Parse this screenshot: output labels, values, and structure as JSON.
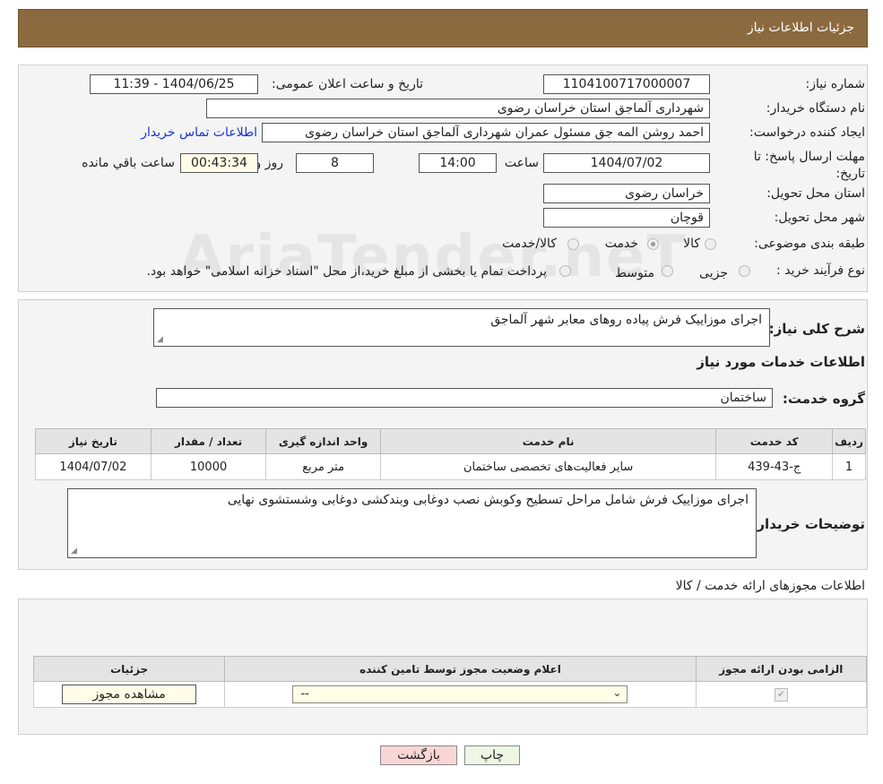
{
  "header": {
    "title": "جزئیات اطلاعات نیاز"
  },
  "watermark": {
    "text": "AriaTender.neT"
  },
  "info": {
    "need_number_label": "شماره نیاز:",
    "need_number": "1104100717000007",
    "announce_label": "تاریخ و ساعت اعلان عمومی:",
    "announce_value": "1404/06/25 - 11:39",
    "buyer_org_label": "نام دستگاه خریدار:",
    "buyer_org": "شهرداری آلماجق استان خراسان رضوی",
    "requester_label": "ایجاد کننده درخواست:",
    "requester": "احمد روشن المه جق مسئول عمران شهرداری آلماجق استان خراسان رضوی",
    "contact_link": "اطلاعات تماس خریدار",
    "deadline_label": "مهلت ارسال پاسخ: تا تاریخ:",
    "deadline_date": "1404/07/02",
    "hour_label": "ساعت",
    "deadline_time": "14:00",
    "days_value": "8",
    "days_label": "روز و",
    "remaining_time": "00:43:34",
    "remaining_label": "ساعت باقي مانده",
    "province_label": "استان محل تحویل:",
    "province": "خراسان رضوی",
    "city_label": "شهر محل تحویل:",
    "city": "قوچان",
    "category_label": "طبقه بندی موضوعی:",
    "category_options": [
      "کالا",
      "خدمت",
      "کالا/خدمت"
    ],
    "category_selected": "خدمت",
    "process_label": "نوع فرآیند خرید :",
    "process_options": [
      "جزیی",
      "متوسط"
    ],
    "process_note": "پرداخت تمام یا بخشی از مبلغ خرید،از محل \"اسناد خزانه اسلامی\" خواهد بود."
  },
  "details": {
    "summary_label": "شرح کلی نیاز:",
    "summary": "اجرای موزاییک فرش پیاده روهای معابر شهر آلماجق",
    "services_title": "اطلاعات خدمات مورد نیاز",
    "service_group_label": "گروه خدمت:",
    "service_group": "ساختمان",
    "table_headers": [
      "ردیف",
      "کد خدمت",
      "نام خدمت",
      "واحد اندازه گیری",
      "تعداد / مقدار",
      "تاریخ نیاز"
    ],
    "table_rows": [
      [
        "1",
        "ج-43-439",
        "سایر فعالیت‌های تخصصی ساختمان",
        "متر مربع",
        "10000",
        "1404/07/02"
      ]
    ],
    "buyer_notes_label": "توضیحات خریدار:",
    "buyer_notes": "اجرای موزاییک فرش شامل مراحل تسطیح وکوبش نصب دوغابی وبندکشی دوغابی وشستشوی نهایی"
  },
  "permits": {
    "title": "اطلاعات مجوزهای ارائه خدمت / کالا",
    "headers": [
      "الزامی بودن ارائه مجوز",
      "اعلام وضعیت مجوز توسط تامین کننده",
      "جزئیات"
    ],
    "select_value": "--",
    "view_button": "مشاهده مجوز"
  },
  "footer": {
    "print_button": "چاپ",
    "back_button": "بازگشت"
  },
  "colors": {
    "header_bg": "#8c6a3f",
    "link": "#1a35c9",
    "back_button_bg": "#f9d6d6",
    "print_button_bg": "#eef7e4"
  }
}
